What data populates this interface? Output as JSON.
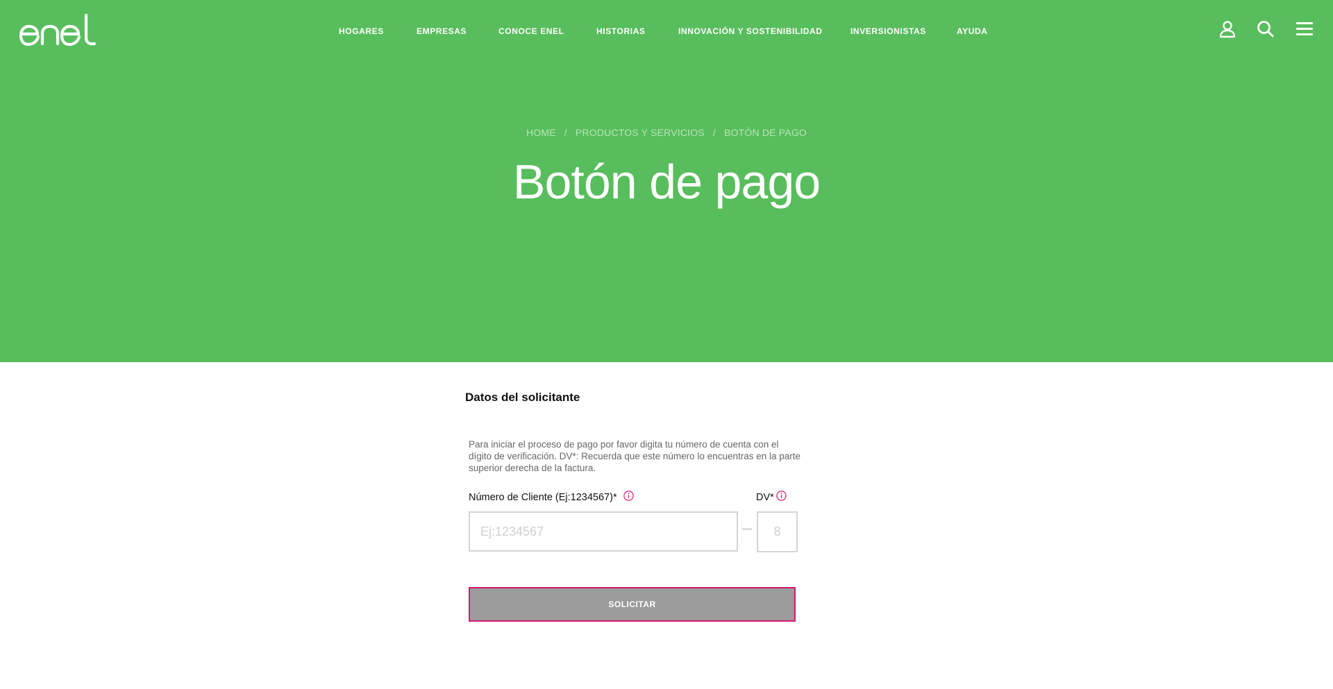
{
  "brand": {
    "name": "enel",
    "color": "#58bd5c",
    "accent": "#d6186f"
  },
  "nav": {
    "items": [
      {
        "label": "HOGARES"
      },
      {
        "label": "EMPRESAS"
      },
      {
        "label": "CONOCE ENEL"
      },
      {
        "label": "HISTORIAS"
      },
      {
        "label": "INNOVACIÓN Y SOSTENIBILIDAD"
      },
      {
        "label": "INVERSIONISTAS"
      },
      {
        "label": "AYUDA"
      }
    ],
    "icons": [
      "user-icon",
      "search-icon",
      "menu-icon"
    ]
  },
  "breadcrumb": {
    "items": [
      {
        "label": "HOME"
      },
      {
        "label": "PRODUCTOS Y SERVICIOS"
      },
      {
        "label": "BOTÓN DE PAGO"
      }
    ],
    "separator": "/"
  },
  "page": {
    "title": "Botón de pago"
  },
  "form": {
    "section_title": "Datos del solicitante",
    "instructions": "Para iniciar el proceso de pago por favor digita tu número de cuenta con el dígito de verificación. DV*: Recuerda que este número lo encuentras en la parte superior derecha de la factura.",
    "client_label": "Número de Cliente (Ej:1234567)*",
    "client_placeholder": "Ej:1234567",
    "dv_label": "DV*",
    "dv_placeholder": "8",
    "submit_label": "SOLICITAR"
  }
}
